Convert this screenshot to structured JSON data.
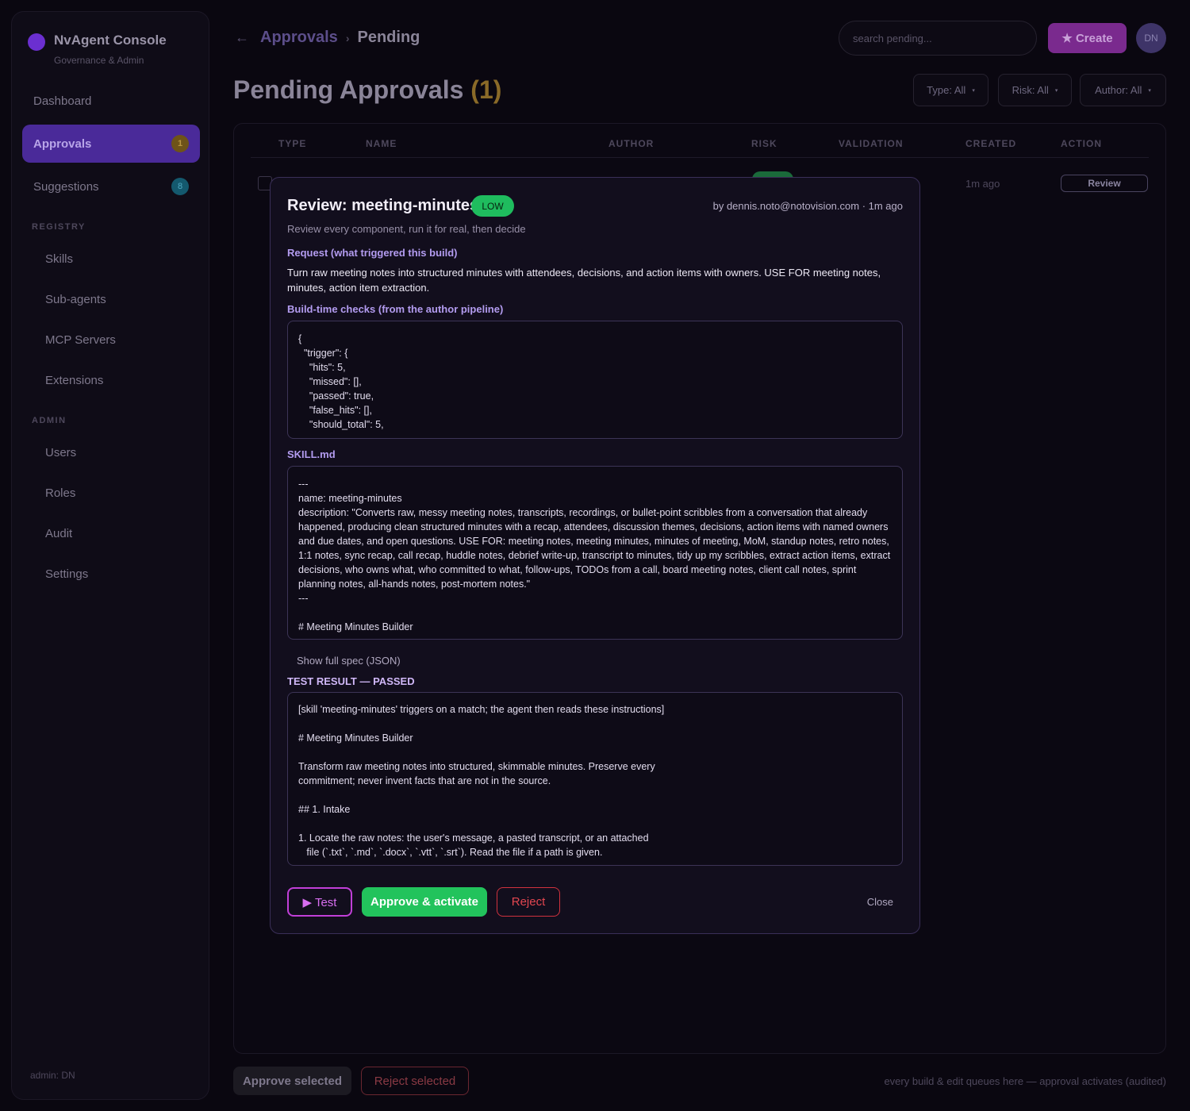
{
  "sidebar": {
    "brand_name": "NvAgent Console",
    "brand_sub": "Governance & Admin",
    "nav": [
      {
        "label": "Dashboard"
      },
      {
        "label": "Approvals",
        "badge": "1"
      },
      {
        "label": "Suggestions",
        "badge": "8"
      }
    ],
    "registry_title": "REGISTRY",
    "registry": [
      "Skills",
      "Sub-agents",
      "MCP Servers",
      "Extensions"
    ],
    "admin_title": "ADMIN",
    "admin": [
      "Users",
      "Roles",
      "Audit",
      "Settings"
    ],
    "footer": "admin: DN"
  },
  "header": {
    "back_icon": "←",
    "breadcrumb_link": "Approvals",
    "breadcrumb_sep": "›",
    "breadcrumb_current": "Pending",
    "search_placeholder": "search pending...",
    "create_label": "★ Create",
    "avatar": "DN"
  },
  "page": {
    "title": "Pending Approvals",
    "count": "(1)",
    "filters": [
      "Type: All",
      "Risk: All",
      "Author: All"
    ],
    "caret": "▾"
  },
  "table": {
    "columns": [
      "TYPE",
      "NAME",
      "AUTHOR",
      "RISK",
      "VALIDATION",
      "CREATED",
      "ACTION"
    ],
    "rows": [
      {
        "created": "1m ago",
        "action": "Review"
      }
    ]
  },
  "bottom": {
    "approve_selected": "Approve selected",
    "reject_selected": "Reject selected",
    "note": "every build & edit queues here — approval activates (audited)"
  },
  "modal": {
    "title": "Review: meeting-minutes",
    "risk": "LOW",
    "meta": "by dennis.noto@notovision.com · 1m ago",
    "subtitle": "Review every component, run it for real, then decide",
    "request_label": "Request (what triggered this build)",
    "request_text": "Turn raw meeting notes into structured minutes with attendees, decisions, and action items with owners. USE FOR meeting notes, minutes, action item extraction.",
    "checks_label": "Build-time checks (from the author pipeline)",
    "checks_code": "{\n  \"trigger\": {\n    \"hits\": 5,\n    \"missed\": [],\n    \"passed\": true,\n    \"false_hits\": [],\n    \"should_total\": 5,",
    "skill_label": "SKILL.md",
    "skill_code": "---\nname: meeting-minutes\ndescription: \"Converts raw, messy meeting notes, transcripts, recordings, or bullet-point scribbles from a conversation that already happened, producing clean structured minutes with a recap, attendees, discussion themes, decisions, action items with named owners and due dates, and open questions. USE FOR: meeting notes, meeting minutes, minutes of meeting, MoM, standup notes, retro notes, 1:1 notes, sync recap, call recap, huddle notes, debrief write-up, transcript to minutes, tidy up my scribbles, extract action items, extract decisions, who owns what, who committed to what, follow-ups, TODOs from a call, board meeting notes, client call notes, sprint planning notes, all-hands notes, post-mortem notes.\"\n---\n\n# Meeting Minutes Builder",
    "show_spec": "Show full spec (JSON)",
    "result_label": "TEST RESULT — PASSED",
    "result_code": "[skill 'meeting-minutes' triggers on a match; the agent then reads these instructions]\n\n# Meeting Minutes Builder\n\nTransform raw meeting notes into structured, skimmable minutes. Preserve every\ncommitment; never invent facts that are not in the source.\n\n## 1. Intake\n\n1. Locate the raw notes: the user's message, a pasted transcript, or an attached\n   file (`.txt`, `.md`, `.docx`, `.vtt`, `.srt`). Read the file if a path is given.",
    "test_label": "▶ Test",
    "approve_label": "Approve & activate",
    "reject_label": "Reject",
    "close_label": "Close"
  }
}
